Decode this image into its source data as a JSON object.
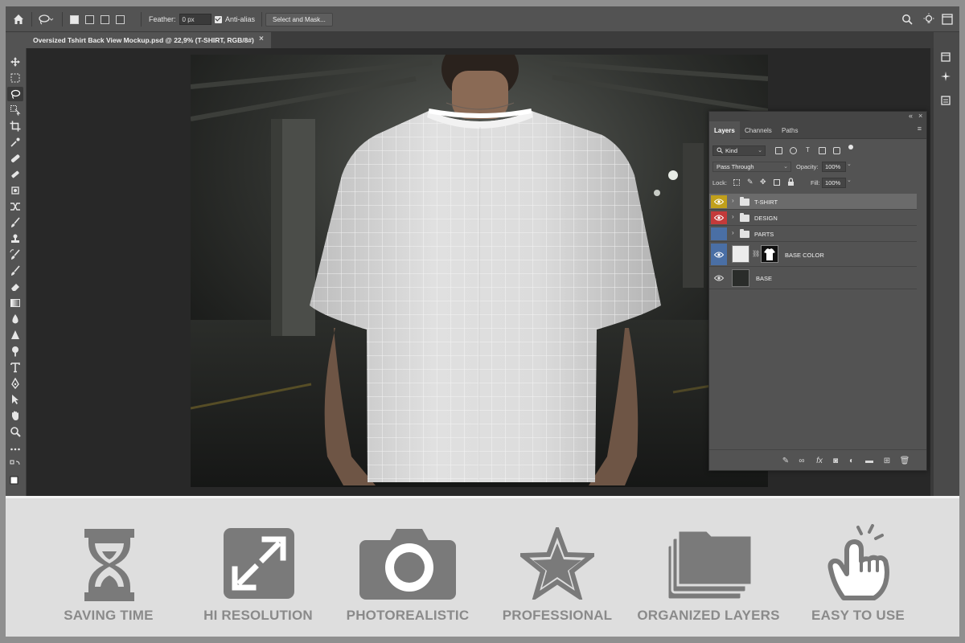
{
  "options_bar": {
    "feather_label": "Feather:",
    "feather_value": "0 px",
    "antialias_label": "Anti-alias",
    "select_mask_label": "Select and Mask..."
  },
  "document": {
    "tab_title": "Oversized Tshirt Back View Mockup.psd @ 22,9% (T-SHIRT, RGB/8#)",
    "close_glyph": "×"
  },
  "layers_panel": {
    "tabs": [
      "Layers",
      "Channels",
      "Paths"
    ],
    "active_tab": "Layers",
    "filter_kind": "Kind",
    "blend_mode": "Pass Through",
    "opacity_label": "Opacity:",
    "opacity_value": "100%",
    "lock_label": "Lock:",
    "fill_label": "Fill:",
    "fill_value": "100%",
    "layers": [
      {
        "name": "T-SHIRT",
        "type": "group",
        "color_tag": "#c1a01b",
        "visible": true,
        "selected": true
      },
      {
        "name": "DESIGN",
        "type": "group",
        "color_tag": "#c43a3a",
        "visible": true,
        "selected": false
      },
      {
        "name": "PARTS",
        "type": "group",
        "color_tag": "#4a6fa5",
        "visible": false,
        "selected": false
      },
      {
        "name": "BASE COLOR",
        "type": "fill-with-mask",
        "color_tag": "#4a6fa5",
        "visible": true,
        "selected": false
      },
      {
        "name": "BASE",
        "type": "image",
        "color_tag": "",
        "visible": true,
        "selected": false
      }
    ]
  },
  "features": [
    {
      "label": "SAVING TIME",
      "icon": "hourglass-icon"
    },
    {
      "label": "HI RESOLUTION",
      "icon": "expand-icon"
    },
    {
      "label": "PHOTOREALISTIC",
      "icon": "camera-icon"
    },
    {
      "label": "PROFESSIONAL",
      "icon": "star-icon"
    },
    {
      "label": "ORGANIZED LAYERS",
      "icon": "layers-icon"
    },
    {
      "label": "EASY TO USE",
      "icon": "tap-hand-icon"
    }
  ],
  "colors": {
    "app_bg": "#535353",
    "canvas_bg": "#282828",
    "feature_icon": "#7a7a7a",
    "feature_label": "#8a8a8a"
  }
}
